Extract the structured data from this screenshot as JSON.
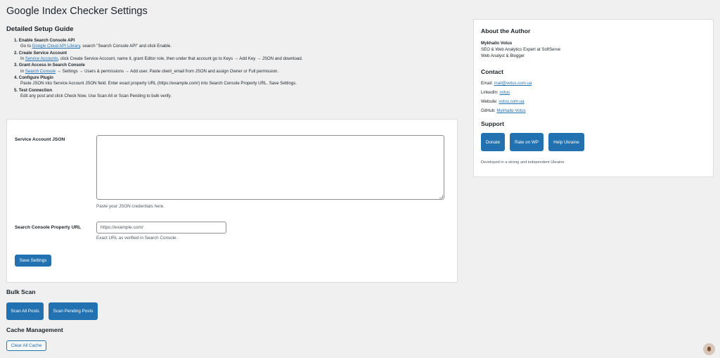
{
  "page": {
    "title": "Google Index Checker Settings"
  },
  "guide": {
    "title": "Detailed Setup Guide",
    "steps": [
      {
        "num": "1.",
        "title": "Enable Search Console API",
        "desc_pre": "Go to ",
        "link": "Google Cloud API Library",
        "desc_post": ", search \"Search Console API\" and click Enable."
      },
      {
        "num": "2.",
        "title": "Create Service Account",
        "desc_pre": "In ",
        "link": "Service Accounts",
        "desc_post": ", click Create Service Account, name it, grant Editor role, then under that account go to Keys → Add Key → JSON and download."
      },
      {
        "num": "3.",
        "title": "Grant Access in Search Console",
        "desc_pre": "In ",
        "link": "Search Console",
        "desc_post": " → Settings → Users & permissions → Add user. Paste client_email from JSON and assign Owner or Full permission."
      },
      {
        "num": "4.",
        "title": "Configure Plugin",
        "desc_pre": "Paste JSON into Service Account JSON field. Enter exact property URL (https://example.com/) into Search Console Property URL. Save Settings.",
        "link": "",
        "desc_post": ""
      },
      {
        "num": "5.",
        "title": "Test Connection",
        "desc_pre": "Edit any post and click Check Now. Use Scan All or Scan Pending to bulk verify.",
        "link": "",
        "desc_post": ""
      }
    ]
  },
  "settings": {
    "json_label": "Service Account JSON",
    "json_value": "",
    "json_hint": "Paste your JSON credentials here.",
    "url_label": "Search Console Property URL",
    "url_placeholder": "https://example.com/",
    "url_value": "",
    "url_hint": "Exact URL as verified in Search Console.",
    "save_label": "Save Settings"
  },
  "bulk": {
    "title": "Bulk Scan",
    "scan_all_label": "Scan All Posts",
    "scan_pending_label": "Scan Pending Posts"
  },
  "cache": {
    "title": "Cache Management",
    "clear_label": "Clear All Cache"
  },
  "author": {
    "title": "About the Author",
    "name": "Mykhailo Votus",
    "role1": "SEO & Web Analytics Expert at SoftServe",
    "role2": "Web Analyst & Blogger"
  },
  "contact": {
    "title": "Contact",
    "email_label": "Email:",
    "email": "mail@votus.com.ua",
    "linkedin_label": "LinkedIn:",
    "linkedin": "votus",
    "website_label": "Website:",
    "website": "votus.com.ua",
    "github_label": "GitHub:",
    "github": "Mykhailo-Votus"
  },
  "support": {
    "title": "Support",
    "donate_label": "Donate",
    "rate_label": "Rate on WP",
    "ukraine_label": "Help Ukraine",
    "footer": "Developed in a strong and independent Ukraine"
  },
  "colors": {
    "primary": "#2271b1",
    "background": "#f0f0f1",
    "card": "#ffffff",
    "text": "#1d2327"
  },
  "icons": {
    "floating": "notification-bell-icon"
  }
}
